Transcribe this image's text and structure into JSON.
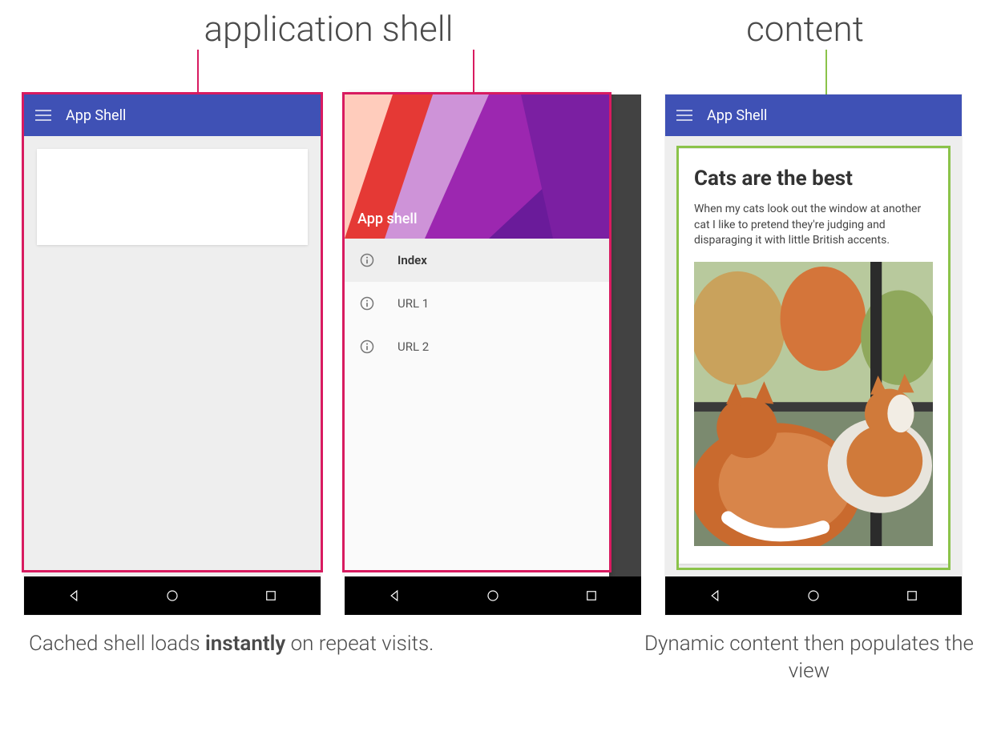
{
  "labels": {
    "shell": "application shell",
    "content": "content"
  },
  "captions": {
    "shell_prefix": "Cached shell loads ",
    "shell_bold": "instantly",
    "shell_suffix": " on repeat visits.",
    "content": "Dynamic content then populates the view"
  },
  "appbar": {
    "title": "App Shell"
  },
  "drawer": {
    "header_title": "App shell",
    "items": [
      {
        "label": "Index",
        "active": true
      },
      {
        "label": "URL 1",
        "active": false
      },
      {
        "label": "URL 2",
        "active": false
      }
    ]
  },
  "article": {
    "title": "Cats are the best",
    "body": "When my cats look out the window at another cat I like to pretend they're judging and disparaging it with little British accents.",
    "image_alt": "Two orange and white cats looking out a window at autumn trees"
  },
  "colors": {
    "appbar": "#3f51b5",
    "pink": "#d81b60",
    "green": "#8bc34a"
  }
}
